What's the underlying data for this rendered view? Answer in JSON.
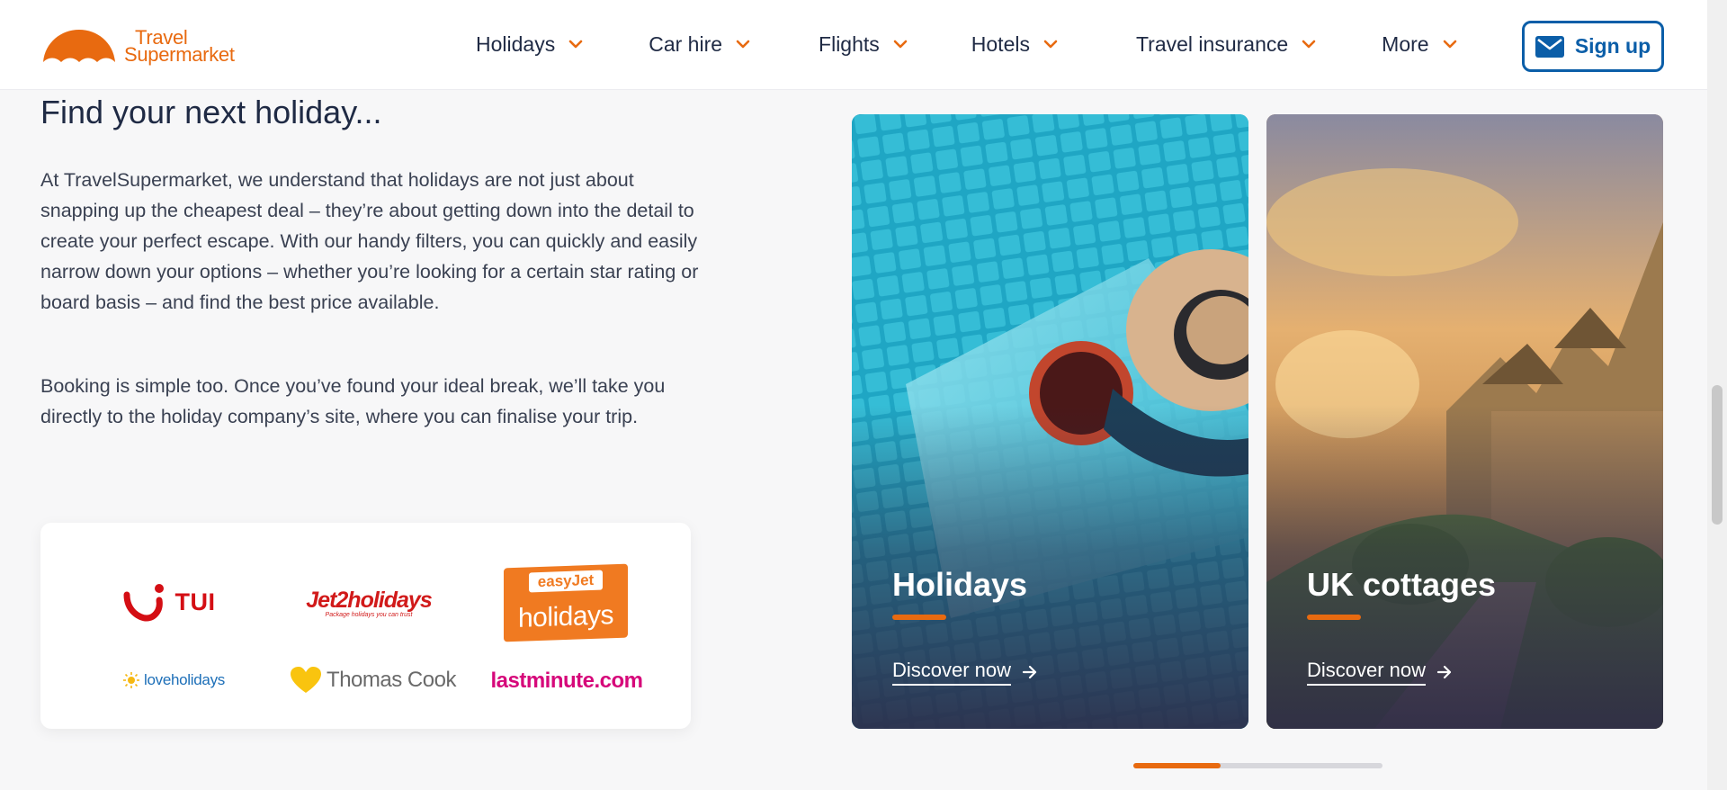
{
  "brand": {
    "line1": "Travel",
    "line2": "Supermarket",
    "color": "#e86a10"
  },
  "nav": {
    "items": [
      {
        "label": "Holidays"
      },
      {
        "label": "Car hire"
      },
      {
        "label": "Flights"
      },
      {
        "label": "Hotels"
      },
      {
        "label": "Travel insurance"
      },
      {
        "label": "More"
      }
    ],
    "signup_label": "Sign up"
  },
  "intro": {
    "heading": "Find your next holiday...",
    "paragraph1": "At TravelSupermarket, we understand that holidays are not just about snapping up the cheapest deal – they’re about getting down into the detail to create your perfect escape. With our handy filters, you can quickly and easily narrow down your options – whether you’re looking for a certain star rating or board basis – and find the best price available.",
    "paragraph2": "Booking is simple too. Once you’ve found your ideal break, we’ll take you directly to the holiday company’s site, where you can finalise your trip."
  },
  "partners": {
    "tui": "TUI",
    "jet2": "Jet2holidays",
    "jet2_tagline": "Package holidays you can trust",
    "easyjet_top": "easyJet",
    "easyjet_main": "holidays",
    "loveholidays": "loveholidays",
    "thomascook": "Thomas Cook",
    "lastminute": "lastminute.com"
  },
  "cards": [
    {
      "title": "Holidays",
      "link": "Discover now",
      "icon": "arrow-right-icon"
    },
    {
      "title": "UK cottages",
      "link": "Discover now",
      "icon": "arrow-right-icon"
    }
  ],
  "carousel": {
    "progress_fraction": 0.35
  },
  "colors": {
    "accent": "#e86a10",
    "signup": "#0b5ea8",
    "text": "#1f2a44"
  }
}
